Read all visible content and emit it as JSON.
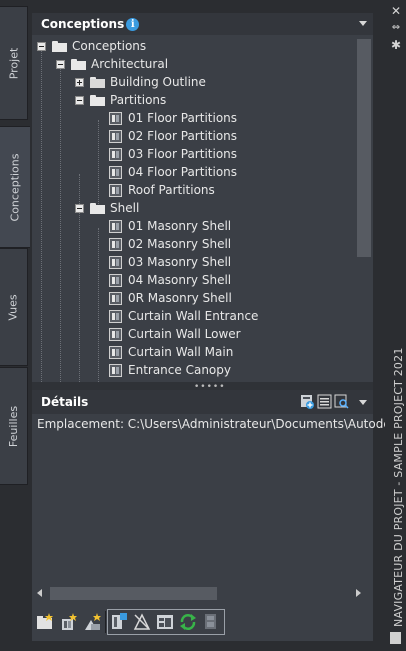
{
  "palette_title": "NAVIGATEUR DU PROJET - SAMPLE PROJECT 2021",
  "side_tabs": [
    "Projet",
    "Conceptions",
    "Vues",
    "Feuilles"
  ],
  "active_tab": "Conceptions",
  "tree_panel": {
    "title": "Conceptions",
    "info_icon": "info-icon",
    "nodes": [
      {
        "label": "Conceptions",
        "level": 0,
        "kind": "folder-open",
        "expander": "minus"
      },
      {
        "label": "Architectural",
        "level": 1,
        "kind": "folder-open",
        "expander": "minus"
      },
      {
        "label": "Building Outline",
        "level": 2,
        "kind": "folder-closed",
        "expander": "plus"
      },
      {
        "label": "Partitions",
        "level": 2,
        "kind": "folder-open",
        "expander": "minus"
      },
      {
        "label": "01 Floor Partitions",
        "level": 3,
        "kind": "construct"
      },
      {
        "label": "02 Floor Partitions",
        "level": 3,
        "kind": "construct"
      },
      {
        "label": "03 Floor Partitions",
        "level": 3,
        "kind": "construct"
      },
      {
        "label": "04 Floor Partitions",
        "level": 3,
        "kind": "construct"
      },
      {
        "label": "Roof Partitions",
        "level": 3,
        "kind": "construct"
      },
      {
        "label": "Shell",
        "level": 2,
        "kind": "folder-open",
        "expander": "minus"
      },
      {
        "label": "01 Masonry Shell",
        "level": 3,
        "kind": "construct"
      },
      {
        "label": "02 Masonry Shell",
        "level": 3,
        "kind": "construct"
      },
      {
        "label": "03 Masonry Shell",
        "level": 3,
        "kind": "construct"
      },
      {
        "label": "04 Masonry Shell",
        "level": 3,
        "kind": "construct"
      },
      {
        "label": "0R Masonry Shell",
        "level": 3,
        "kind": "construct"
      },
      {
        "label": "Curtain Wall Entrance",
        "level": 3,
        "kind": "construct"
      },
      {
        "label": "Curtain Wall Lower",
        "level": 3,
        "kind": "construct"
      },
      {
        "label": "Curtain Wall Main",
        "level": 3,
        "kind": "construct"
      },
      {
        "label": "Entrance Canopy",
        "level": 3,
        "kind": "construct"
      }
    ]
  },
  "details": {
    "title": "Détails",
    "location_text": "Emplacement: C:\\Users\\Administrateur\\Documents\\Autodesk\\M",
    "header_icons": [
      "add-view-icon",
      "list-view-icon",
      "preview-icon"
    ]
  },
  "toolbar_icons": [
    "add-category-icon",
    "add-construct-icon",
    "add-element-icon",
    "open-in-explorer-icon",
    "regenerate-icon",
    "repath-icon",
    "refresh-icon",
    "version-history-icon"
  ],
  "colors": {
    "panel": "#3b3f46",
    "header": "#33363c",
    "background": "#2b2d31",
    "accent_info": "#3a9be0",
    "refresh_green": "#38b449"
  }
}
